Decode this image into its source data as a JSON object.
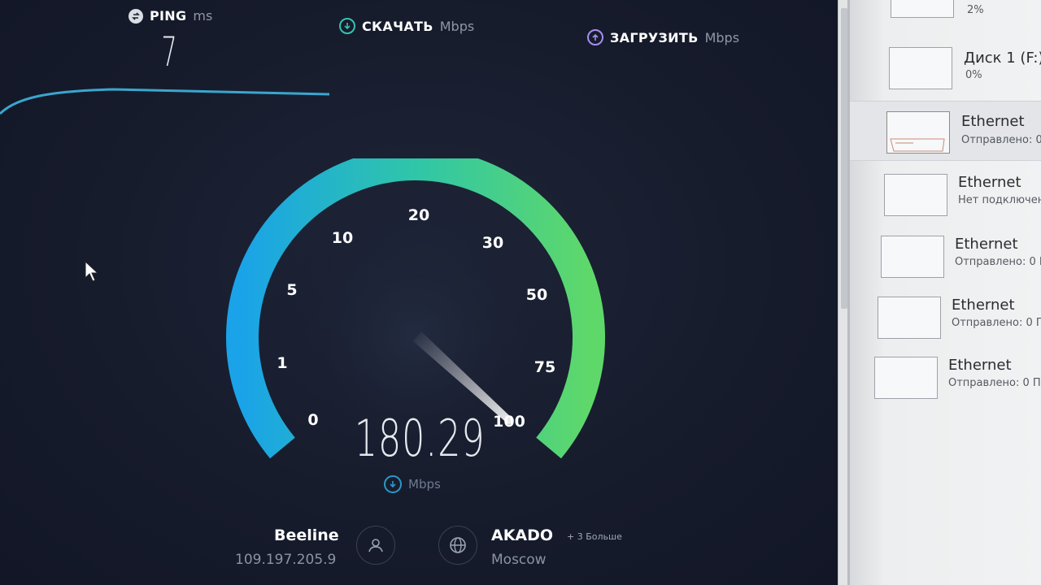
{
  "speedtest": {
    "ping": {
      "label": "PING",
      "unit": "ms",
      "value": "7"
    },
    "download": {
      "label": "СКАЧАТЬ",
      "unit": "Mbps"
    },
    "upload": {
      "label": "ЗАГРУЗИТЬ",
      "unit": "Mbps"
    },
    "gauge": {
      "ticks": [
        "0",
        "1",
        "5",
        "10",
        "20",
        "30",
        "50",
        "75",
        "100"
      ],
      "value": "180.29",
      "unit": "Mbps"
    },
    "provider": {
      "name": "Beeline",
      "ip": "109.197.205.9"
    },
    "server": {
      "name": "AKADO",
      "more": "+ 3 Больше",
      "city": "Moscow"
    },
    "colors": {
      "gauge_start": "#1aa3e8",
      "gauge_mid": "#2fc6a8",
      "gauge_end": "#5fd86a",
      "background": "#161b2b"
    },
    "icons": {
      "ping": "ping-icon",
      "download": "download-icon",
      "upload": "upload-icon",
      "user": "user-icon",
      "globe": "globe-icon"
    }
  },
  "task_manager": {
    "items": [
      {
        "title": "",
        "sub": "2%"
      },
      {
        "title": "Диск 1 (F:)",
        "sub": "0%"
      },
      {
        "title": "Ethernet",
        "sub": "Отправлено: 0"
      },
      {
        "title": "Ethernet",
        "sub": "Нет подключен"
      },
      {
        "title": "Ethernet",
        "sub": "Отправлено: 0 П"
      },
      {
        "title": "Ethernet",
        "sub": "Отправлено: 0 П"
      },
      {
        "title": "Ethernet",
        "sub": "Отправлено: 0 П"
      }
    ]
  }
}
